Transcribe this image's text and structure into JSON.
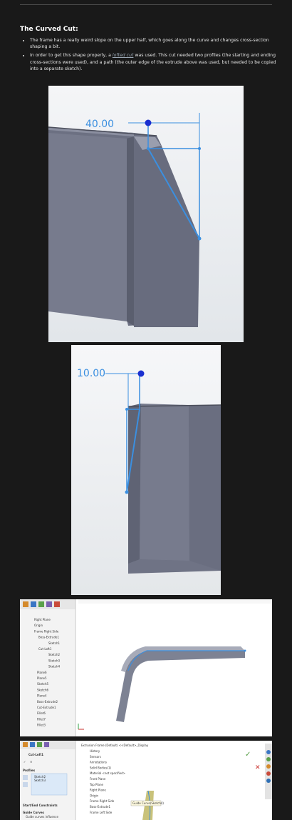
{
  "section": {
    "heading": "The Curved Cut:",
    "bullet1": "The frame has a really weird slope on the upper half, which goes along the curve and changes cross-section shaping a bit.",
    "bullet2_before": "In order to get this shape properly, a ",
    "bullet2_link": "lofted cut",
    "bullet2_after": " was used. This cut needed two profiles (the starting and ending cross-sections were used), and a path (the outer edge of the extrude above was used, but needed to be copied into a separate sketch)."
  },
  "figure1": {
    "dimension": "40.00"
  },
  "figure2": {
    "dimension": "10.00"
  },
  "figure3": {
    "tree": [
      "Right Plane",
      "Origin",
      "Frame Right Side",
      "Boss-Extrude1",
      "Sketch1",
      "Cut-Loft1",
      "Sketch2",
      "Sketch3",
      "Sketch4",
      "Plane6",
      "Plane5",
      "Sketch5",
      "Sketch6",
      "Plane4",
      "Boss-Extrude2",
      "Cut-Extrude1",
      "Fillet6",
      "Fillet7",
      "Fillet3"
    ]
  },
  "figure4": {
    "panel_title": "Cut-Loft1",
    "profiles_label": "Profiles",
    "profiles": [
      "Sketch2",
      "Sketch3"
    ],
    "start_end_label": "Start/End Constraints",
    "guide_label": "Guide Curves",
    "guide_influence": "Guide curves influence",
    "tree": [
      "History",
      "Sensors",
      "Annotations",
      "Solid Bodies(1)",
      "Material <not specified>",
      "Front Plane",
      "Top Plane",
      "Right Plane",
      "Origin",
      "Frame Right Side",
      "Boss-Extrude1",
      "Frame Left Side"
    ],
    "breadcrumb": "Extrusion Frame (Default) <<Default>_Display",
    "tooltip": "Guide Curve(Sketch4)"
  },
  "colors": {
    "accent": "#3b8fe0",
    "body": "#727688",
    "background": "#191919"
  }
}
